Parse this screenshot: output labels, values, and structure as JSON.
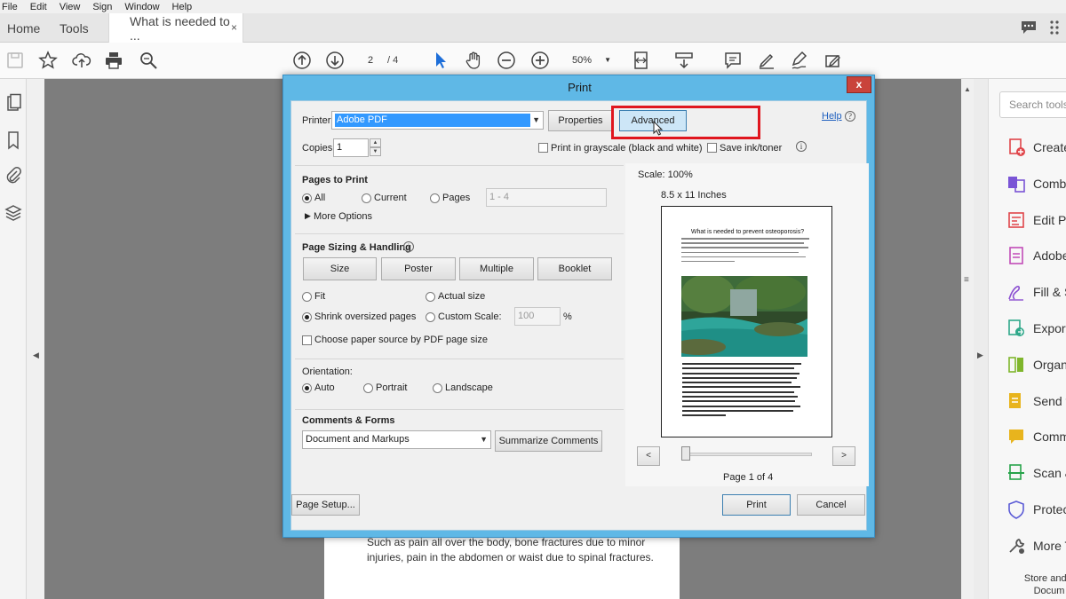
{
  "menu": [
    "File",
    "Edit",
    "View",
    "Sign",
    "Window",
    "Help"
  ],
  "tabs": {
    "home": "Home",
    "tools": "Tools",
    "document": "What is needed to ...",
    "close_glyph": "×"
  },
  "toolbar": {
    "page_current": "2",
    "page_total": "/ 4",
    "zoom": "50%"
  },
  "document": {
    "text": "Such as pain all over the body, bone fractures due to minor injuries, pain in the abdomen or waist due to spinal fractures."
  },
  "tools_pane": {
    "search_placeholder": "Search tools",
    "items": [
      {
        "label": "Create",
        "icon": "create-pdf-icon",
        "color": "#e0454a"
      },
      {
        "label": "Combi",
        "icon": "combine-files-icon",
        "color": "#7a54d6"
      },
      {
        "label": "Edit PD",
        "icon": "edit-pdf-icon",
        "color": "#e0454a"
      },
      {
        "label": "Adobe",
        "icon": "adobe-sign-icon",
        "color": "#c24bb8"
      },
      {
        "label": "Fill & S",
        "icon": "fill-sign-icon",
        "color": "#8b4fd1"
      },
      {
        "label": "Export",
        "icon": "export-pdf-icon",
        "color": "#2fa88a"
      },
      {
        "label": "Organ",
        "icon": "organize-pages-icon",
        "color": "#7fb62c"
      },
      {
        "label": "Send f",
        "icon": "send-for-comments-icon",
        "color": "#e8b41d"
      },
      {
        "label": "Comm",
        "icon": "comment-icon",
        "color": "#e8b41d"
      },
      {
        "label": "Scan &",
        "icon": "scan-ocr-icon",
        "color": "#27a34a"
      },
      {
        "label": "Protec",
        "icon": "protect-icon",
        "color": "#5b5bd6"
      },
      {
        "label": "More T",
        "icon": "more-tools-icon",
        "color": "#555555"
      }
    ],
    "store_text_1": "Store and s",
    "store_text_2": "Docum"
  },
  "print_dialog": {
    "title": "Print",
    "close_glyph": "x",
    "printer_label": "Printer:",
    "printer_value": "Adobe PDF",
    "properties_label": "Properties",
    "advanced_label": "Advanced",
    "help_label": "Help",
    "copies_label": "Copies:",
    "copies_value": "1",
    "grayscale_label": "Print in grayscale (black and white)",
    "save_ink_label": "Save ink/toner",
    "pages_to_print": {
      "heading": "Pages to Print",
      "all": "All",
      "current": "Current",
      "pages": "Pages",
      "pages_range": "1 - 4",
      "more_options": "More Options",
      "selected": "All"
    },
    "sizing": {
      "heading": "Page Sizing & Handling",
      "buttons": [
        "Size",
        "Poster",
        "Multiple",
        "Booklet"
      ],
      "fit": "Fit",
      "actual_size": "Actual size",
      "shrink": "Shrink oversized pages",
      "custom_scale": "Custom Scale:",
      "custom_scale_value": "100",
      "percent": "%",
      "paper_source": "Choose paper source by PDF page size",
      "selected": "Shrink oversized pages"
    },
    "orientation": {
      "heading": "Orientation:",
      "auto": "Auto",
      "portrait": "Portrait",
      "landscape": "Landscape",
      "selected": "Auto"
    },
    "comments": {
      "heading": "Comments & Forms",
      "value": "Document and Markups",
      "summarize": "Summarize Comments"
    },
    "preview": {
      "scale": "Scale: 100%",
      "paper_size": "8.5 x 11 Inches",
      "doc_title": "What is needed to prevent osteoporosis?",
      "page_indicator": "Page 1 of 4",
      "prev": "<",
      "next": ">"
    },
    "page_setup_label": "Page Setup...",
    "print_label": "Print",
    "cancel_label": "Cancel"
  }
}
